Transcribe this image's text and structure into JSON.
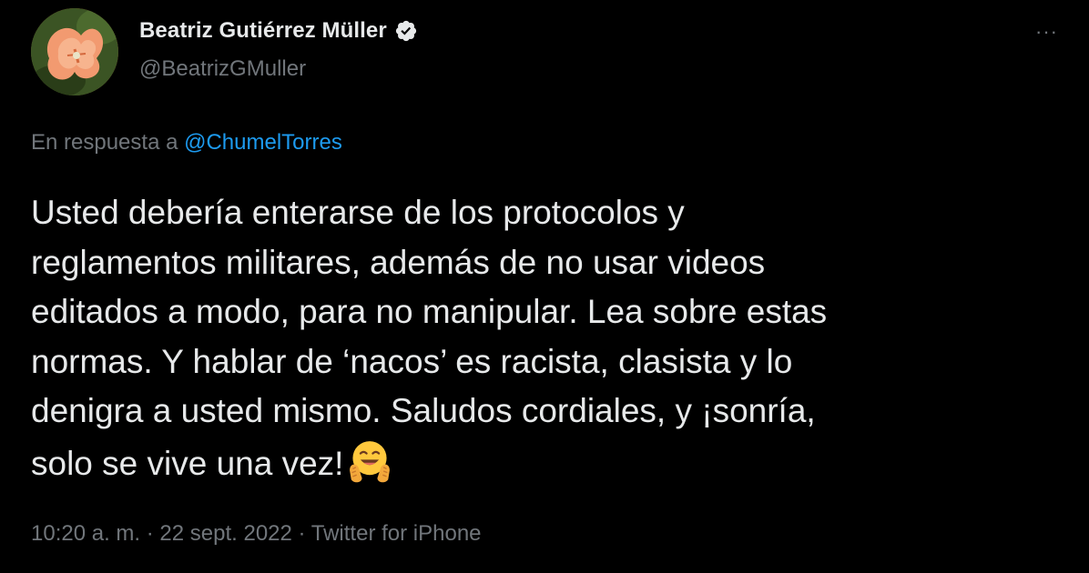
{
  "author": {
    "display_name": "Beatriz Gutiérrez Müller",
    "handle": "@BeatrizGMuller",
    "verified_icon": "verified-badge-icon",
    "avatar_icon": "flower-avatar"
  },
  "menu": {
    "more_label": "···"
  },
  "reply": {
    "prefix": "En respuesta a",
    "mention": "@ChumelTorres"
  },
  "tweet": {
    "text": "Usted debería enterarse de los protocolos y\nreglamentos militares, además de no usar videos\neditados a modo, para no manipular. Lea sobre estas\nnormas. Y hablar de ‘nacos’ es racista, clasista y lo\ndenigra a usted mismo. Saludos cordiales, y ¡sonría,\nsolo se vive una vez!",
    "emoji": "hugging-face-emoji"
  },
  "meta": {
    "time": "10:20 a. m.",
    "sep1": " · ",
    "date": "22 sept. 2022",
    "sep2": " · ",
    "source": "Twitter for iPhone"
  },
  "colors": {
    "background": "#000000",
    "text": "#e7e9ea",
    "secondary": "#71767b",
    "link": "#1d9bf0"
  }
}
